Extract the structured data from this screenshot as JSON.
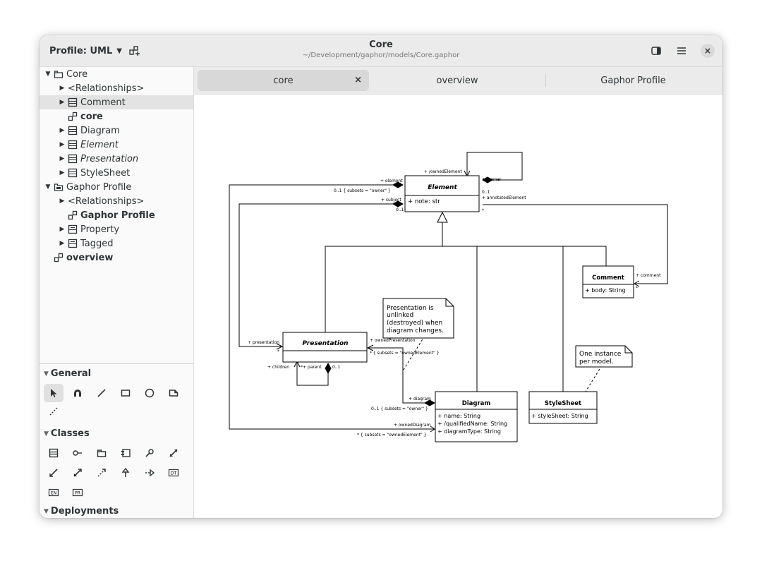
{
  "window": {
    "title": "Core",
    "subtitle": "~/Development/gaphor/models/Core.gaphor"
  },
  "header": {
    "profile_label": "Profile: UML",
    "new_diagram_icon": "diagram-add-icon",
    "sidebar_toggle_icon": "sidebar-toggle-icon",
    "menu_icon": "hamburger-menu-icon",
    "close_symbol": "×"
  },
  "tree": {
    "items": [
      {
        "label": "Core",
        "icon": "package-icon",
        "expanded": true
      },
      {
        "label": "<Relationships>",
        "icon": "",
        "expanded": false
      },
      {
        "label": "Comment",
        "icon": "class-icon",
        "expanded": false,
        "selected": true
      },
      {
        "label": "core",
        "icon": "diagram-icon",
        "style": "bold"
      },
      {
        "label": "Diagram",
        "icon": "class-icon",
        "expanded": false
      },
      {
        "label": "Element",
        "icon": "class-icon",
        "expanded": false,
        "style": "italic"
      },
      {
        "label": "Presentation",
        "icon": "class-icon",
        "expanded": false,
        "style": "italic"
      },
      {
        "label": "StyleSheet",
        "icon": "class-icon",
        "expanded": false
      },
      {
        "label": "Gaphor Profile",
        "icon": "profile-icon",
        "expanded": true
      },
      {
        "label": "<Relationships>",
        "icon": "",
        "expanded": false
      },
      {
        "label": "Gaphor Profile",
        "icon": "diagram-icon",
        "style": "bold"
      },
      {
        "label": "Property",
        "icon": "stereotype-icon",
        "expanded": false
      },
      {
        "label": "Tagged",
        "icon": "stereotype-icon",
        "expanded": false
      },
      {
        "label": "overview",
        "icon": "diagram-icon",
        "style": "bold"
      }
    ]
  },
  "toolbox": {
    "sections": [
      {
        "label": "General"
      },
      {
        "label": "Classes"
      },
      {
        "label": "Deployments"
      }
    ],
    "general_tools": [
      "pointer-icon",
      "magnet-icon",
      "line-icon",
      "box-icon",
      "ellipse-icon",
      "comment-icon",
      "comment-line-icon"
    ],
    "classes_tools": [
      "class-icon",
      "interface-icon",
      "package-icon",
      "component-icon",
      "pin-icon",
      "association-icon",
      "shared-association-icon",
      "composite-association-icon",
      "dependency-icon",
      "generalization-icon",
      "implementation-icon",
      "datatype-icon",
      "enumeration-icon",
      "primitive-icon"
    ],
    "badge_labels": {
      "datatype": "DT",
      "enumeration": "EN",
      "primitive": "PR"
    }
  },
  "tabs": [
    {
      "label": "core",
      "active": true,
      "close": "×"
    },
    {
      "label": "overview",
      "active": false
    },
    {
      "label": "Gaphor Profile",
      "active": false
    }
  ],
  "diagram": {
    "classes": {
      "element": {
        "name": "Element",
        "attrs": [
          "+ note: str"
        ]
      },
      "comment": {
        "name": "Comment",
        "attrs": [
          "+ body: String"
        ]
      },
      "presentation": {
        "name": "Presentation",
        "attrs": []
      },
      "diagram": {
        "name": "Diagram",
        "attrs": [
          "+ name: String",
          "+ /qualifiedName: String",
          "+ diagramType: String"
        ]
      },
      "stylesheet": {
        "name": "StyleSheet",
        "attrs": [
          "+ styleSheet: String"
        ]
      }
    },
    "notes": {
      "presentation_note": [
        "Presentation is",
        "unlinked",
        "(destroyed) when",
        "diagram changes."
      ],
      "stylesheet_note": [
        "One instance",
        "per model."
      ]
    },
    "labels": {
      "owned_element": "+ /ownedElement",
      "owner": "+ /owner",
      "owner_mult": "0..1",
      "element": "+ element",
      "element_subsets": "0..1 { subsets = \"owner\" }",
      "subject": "+ subject",
      "subject_mult": "0..1",
      "annotated_element": "+ annotatedElement",
      "annotated_mult": "*",
      "comment": "+ comment",
      "comment_mult": "*",
      "presentation": "+ presentation",
      "presentation_mult": "*",
      "owned_presentation": "+ ownedPresentation",
      "owned_presentation_subsets": "* { subsets = \"ownedElement\" }",
      "children": "+ children",
      "parent": "*+ parent",
      "parent_mult": "0..1",
      "diagram_role": "+ diagram",
      "diagram_subsets": "0..1 { subsets = \"owner\" }",
      "owned_diagram": "+ ownedDiagram",
      "owned_diagram_subsets": "* { subsets = \"ownedElement\" }"
    }
  }
}
